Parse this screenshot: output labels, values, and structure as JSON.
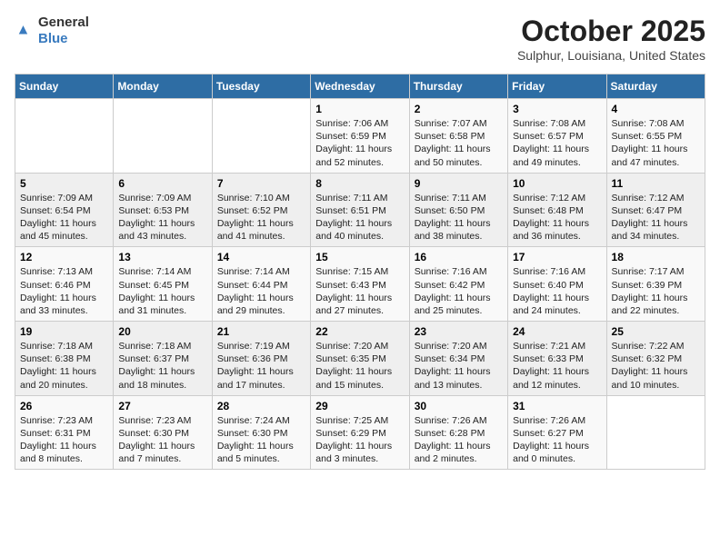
{
  "header": {
    "logo_general": "General",
    "logo_blue": "Blue",
    "title": "October 2025",
    "subtitle": "Sulphur, Louisiana, United States"
  },
  "calendar": {
    "days_of_week": [
      "Sunday",
      "Monday",
      "Tuesday",
      "Wednesday",
      "Thursday",
      "Friday",
      "Saturday"
    ],
    "weeks": [
      [
        {
          "day": "",
          "info": ""
        },
        {
          "day": "",
          "info": ""
        },
        {
          "day": "",
          "info": ""
        },
        {
          "day": "1",
          "info": "Sunrise: 7:06 AM\nSunset: 6:59 PM\nDaylight: 11 hours\nand 52 minutes."
        },
        {
          "day": "2",
          "info": "Sunrise: 7:07 AM\nSunset: 6:58 PM\nDaylight: 11 hours\nand 50 minutes."
        },
        {
          "day": "3",
          "info": "Sunrise: 7:08 AM\nSunset: 6:57 PM\nDaylight: 11 hours\nand 49 minutes."
        },
        {
          "day": "4",
          "info": "Sunrise: 7:08 AM\nSunset: 6:55 PM\nDaylight: 11 hours\nand 47 minutes."
        }
      ],
      [
        {
          "day": "5",
          "info": "Sunrise: 7:09 AM\nSunset: 6:54 PM\nDaylight: 11 hours\nand 45 minutes."
        },
        {
          "day": "6",
          "info": "Sunrise: 7:09 AM\nSunset: 6:53 PM\nDaylight: 11 hours\nand 43 minutes."
        },
        {
          "day": "7",
          "info": "Sunrise: 7:10 AM\nSunset: 6:52 PM\nDaylight: 11 hours\nand 41 minutes."
        },
        {
          "day": "8",
          "info": "Sunrise: 7:11 AM\nSunset: 6:51 PM\nDaylight: 11 hours\nand 40 minutes."
        },
        {
          "day": "9",
          "info": "Sunrise: 7:11 AM\nSunset: 6:50 PM\nDaylight: 11 hours\nand 38 minutes."
        },
        {
          "day": "10",
          "info": "Sunrise: 7:12 AM\nSunset: 6:48 PM\nDaylight: 11 hours\nand 36 minutes."
        },
        {
          "day": "11",
          "info": "Sunrise: 7:12 AM\nSunset: 6:47 PM\nDaylight: 11 hours\nand 34 minutes."
        }
      ],
      [
        {
          "day": "12",
          "info": "Sunrise: 7:13 AM\nSunset: 6:46 PM\nDaylight: 11 hours\nand 33 minutes."
        },
        {
          "day": "13",
          "info": "Sunrise: 7:14 AM\nSunset: 6:45 PM\nDaylight: 11 hours\nand 31 minutes."
        },
        {
          "day": "14",
          "info": "Sunrise: 7:14 AM\nSunset: 6:44 PM\nDaylight: 11 hours\nand 29 minutes."
        },
        {
          "day": "15",
          "info": "Sunrise: 7:15 AM\nSunset: 6:43 PM\nDaylight: 11 hours\nand 27 minutes."
        },
        {
          "day": "16",
          "info": "Sunrise: 7:16 AM\nSunset: 6:42 PM\nDaylight: 11 hours\nand 25 minutes."
        },
        {
          "day": "17",
          "info": "Sunrise: 7:16 AM\nSunset: 6:40 PM\nDaylight: 11 hours\nand 24 minutes."
        },
        {
          "day": "18",
          "info": "Sunrise: 7:17 AM\nSunset: 6:39 PM\nDaylight: 11 hours\nand 22 minutes."
        }
      ],
      [
        {
          "day": "19",
          "info": "Sunrise: 7:18 AM\nSunset: 6:38 PM\nDaylight: 11 hours\nand 20 minutes."
        },
        {
          "day": "20",
          "info": "Sunrise: 7:18 AM\nSunset: 6:37 PM\nDaylight: 11 hours\nand 18 minutes."
        },
        {
          "day": "21",
          "info": "Sunrise: 7:19 AM\nSunset: 6:36 PM\nDaylight: 11 hours\nand 17 minutes."
        },
        {
          "day": "22",
          "info": "Sunrise: 7:20 AM\nSunset: 6:35 PM\nDaylight: 11 hours\nand 15 minutes."
        },
        {
          "day": "23",
          "info": "Sunrise: 7:20 AM\nSunset: 6:34 PM\nDaylight: 11 hours\nand 13 minutes."
        },
        {
          "day": "24",
          "info": "Sunrise: 7:21 AM\nSunset: 6:33 PM\nDaylight: 11 hours\nand 12 minutes."
        },
        {
          "day": "25",
          "info": "Sunrise: 7:22 AM\nSunset: 6:32 PM\nDaylight: 11 hours\nand 10 minutes."
        }
      ],
      [
        {
          "day": "26",
          "info": "Sunrise: 7:23 AM\nSunset: 6:31 PM\nDaylight: 11 hours\nand 8 minutes."
        },
        {
          "day": "27",
          "info": "Sunrise: 7:23 AM\nSunset: 6:30 PM\nDaylight: 11 hours\nand 7 minutes."
        },
        {
          "day": "28",
          "info": "Sunrise: 7:24 AM\nSunset: 6:30 PM\nDaylight: 11 hours\nand 5 minutes."
        },
        {
          "day": "29",
          "info": "Sunrise: 7:25 AM\nSunset: 6:29 PM\nDaylight: 11 hours\nand 3 minutes."
        },
        {
          "day": "30",
          "info": "Sunrise: 7:26 AM\nSunset: 6:28 PM\nDaylight: 11 hours\nand 2 minutes."
        },
        {
          "day": "31",
          "info": "Sunrise: 7:26 AM\nSunset: 6:27 PM\nDaylight: 11 hours\nand 0 minutes."
        },
        {
          "day": "",
          "info": ""
        }
      ]
    ]
  }
}
